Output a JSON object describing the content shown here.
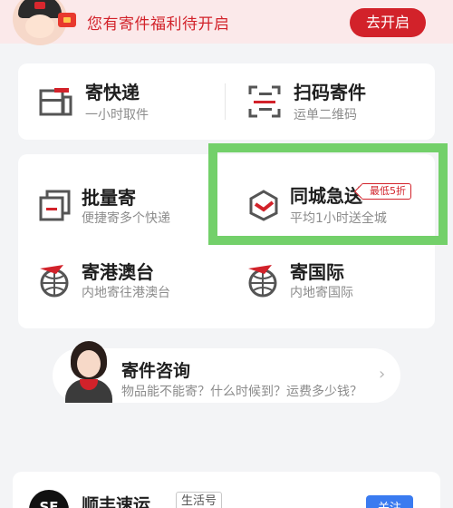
{
  "banner": {
    "text": "您有寄件福利待开启",
    "button": "去开启"
  },
  "top_services": [
    {
      "title": "寄快递",
      "subtitle": "一小时取件",
      "icon": "send-package-icon"
    },
    {
      "title": "扫码寄件",
      "subtitle": "运单二维码",
      "icon": "scan-qr-icon"
    }
  ],
  "grid_services": [
    {
      "title": "批量寄",
      "subtitle": "便捷寄多个快递",
      "icon": "batch-send-icon"
    },
    {
      "title": "同城急送",
      "subtitle": "平均1小时送全城",
      "icon": "same-city-icon",
      "tag": "最低5折"
    },
    {
      "title": "寄港澳台",
      "subtitle": "内地寄往港澳台",
      "icon": "globe-plane-icon"
    },
    {
      "title": "寄国际",
      "subtitle": "内地寄国际",
      "icon": "globe-plane-icon"
    }
  ],
  "consult": {
    "title": "寄件咨询",
    "subtitle": "物品能不能寄？什么时候到？运费多少钱？"
  },
  "account": {
    "name": "顺丰速运",
    "badge": "生活号",
    "follow": "关注",
    "logo_text": "SF"
  },
  "colors": {
    "brand_red": "#d2222a",
    "highlight_green": "#73d06a",
    "follow_blue": "#3a7bf0"
  }
}
